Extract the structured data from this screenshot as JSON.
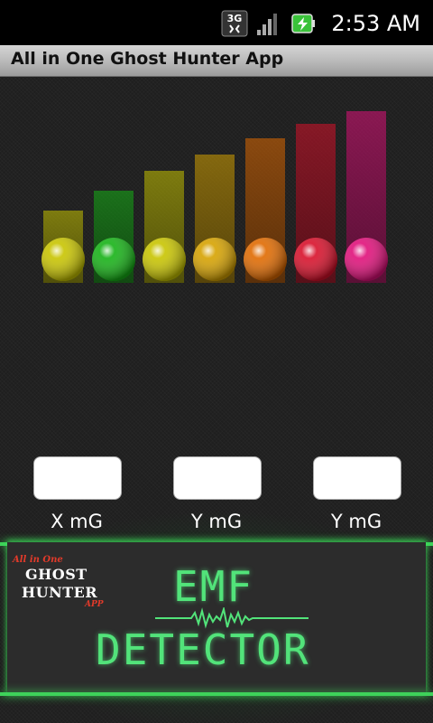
{
  "status_bar": {
    "time": "2:53 AM",
    "network_label": "3G",
    "icons": [
      "network-3g-icon",
      "signal-strength-icon",
      "battery-charging-icon"
    ]
  },
  "title_bar": {
    "title": "All in One Ghost Hunter App"
  },
  "emf_meter": {
    "level_colors": [
      "#c8c400",
      "#16b216",
      "#c8c400",
      "#d6a200",
      "#e06a00",
      "#d8102a",
      "#e0107a"
    ]
  },
  "readings": {
    "x_label": "X mG",
    "y_label": "Y mG",
    "z_label": "Y mG"
  },
  "banner": {
    "logo_top": "All in One",
    "logo_line1": "GHOST",
    "logo_line2": "HUNTER",
    "logo_bottom": "APP",
    "title_line1": "EMF",
    "title_line2": "DETECTOR",
    "accent_color": "#52e37a"
  }
}
